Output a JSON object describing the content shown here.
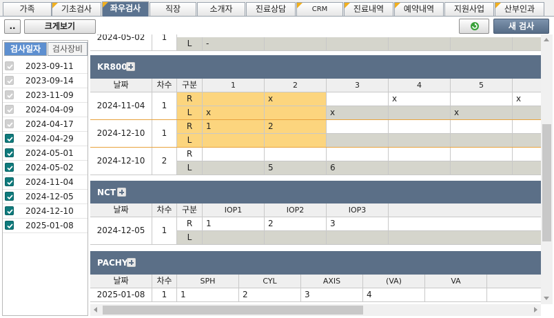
{
  "tabs": [
    {
      "label": "가족",
      "flag": false
    },
    {
      "label": "기초검사",
      "flag": true
    },
    {
      "label": "좌우검사",
      "flag": true,
      "active": true
    },
    {
      "label": "직장",
      "flag": false
    },
    {
      "label": "소개자",
      "flag": false
    },
    {
      "label": "진료상담",
      "flag": false
    },
    {
      "label": "CRM",
      "flag": true
    },
    {
      "label": "진료내역",
      "flag": true
    },
    {
      "label": "예약내역",
      "flag": true
    },
    {
      "label": "지원사업",
      "flag": false
    },
    {
      "label": "산부인과",
      "flag": true
    }
  ],
  "toolbar": {
    "dots_label": "..",
    "zoom_label": "크게보기",
    "refresh_icon": "refresh-icon",
    "new_test_label": "새 검사"
  },
  "left": {
    "tab_date": "검사일자",
    "tab_device": "검사장비",
    "dates": [
      {
        "date": "2023-09-11",
        "checked": "gray"
      },
      {
        "date": "2023-09-14",
        "checked": "gray"
      },
      {
        "date": "2023-11-09",
        "checked": "gray"
      },
      {
        "date": "2024-04-09",
        "checked": "gray"
      },
      {
        "date": "2024-04-17",
        "checked": "gray"
      },
      {
        "date": "2024-04-29",
        "checked": "teal"
      },
      {
        "date": "2024-05-01",
        "checked": "teal"
      },
      {
        "date": "2024-05-02",
        "checked": "teal"
      },
      {
        "date": "2024-11-04",
        "checked": "teal"
      },
      {
        "date": "2024-12-05",
        "checked": "teal"
      },
      {
        "date": "2024-12-10",
        "checked": "teal"
      },
      {
        "date": "2025-01-08",
        "checked": "teal"
      }
    ]
  },
  "top_partial": {
    "date": "2024-05-02",
    "count": "1",
    "r_val": "",
    "l_label": "L",
    "l_val": "-"
  },
  "common": {
    "date_header": "날짜",
    "count_header": "차수",
    "div_header": "구분",
    "r": "R",
    "l": "L"
  },
  "kr800": {
    "title": "KR800",
    "columns": [
      "1",
      "2",
      "3",
      "4",
      "5"
    ],
    "rows": [
      {
        "date": "2024-11-04",
        "count": "1",
        "r": [
          "",
          "x",
          "",
          "x",
          "",
          "x"
        ],
        "l": [
          "x",
          "",
          "x",
          "",
          "x",
          ""
        ]
      },
      {
        "date": "2024-12-10",
        "count": "1",
        "r": [
          "1",
          "2",
          "",
          "",
          "",
          ""
        ],
        "l": [
          "",
          "",
          "",
          "",
          "",
          ""
        ]
      },
      {
        "date": "2024-12-10",
        "count": "2",
        "r": [
          "",
          "",
          "",
          "",
          "",
          ""
        ],
        "l": [
          "",
          "5",
          "6",
          "",
          "",
          ""
        ]
      }
    ]
  },
  "nct": {
    "title": "NCT",
    "columns": [
      "IOP1",
      "IOP2",
      "IOP3"
    ],
    "row": {
      "date": "2024-12-05",
      "count": "1",
      "r": [
        "1",
        "2",
        "3"
      ],
      "l": [
        "",
        "",
        ""
      ]
    }
  },
  "pachy": {
    "title": "PACHY",
    "columns": [
      "SPH",
      "CYL",
      "AXIS",
      "(VA)",
      "VA"
    ],
    "row": {
      "date": "2025-01-08",
      "count": "1",
      "values": [
        "1",
        "2",
        "3",
        "4",
        ""
      ]
    }
  }
}
